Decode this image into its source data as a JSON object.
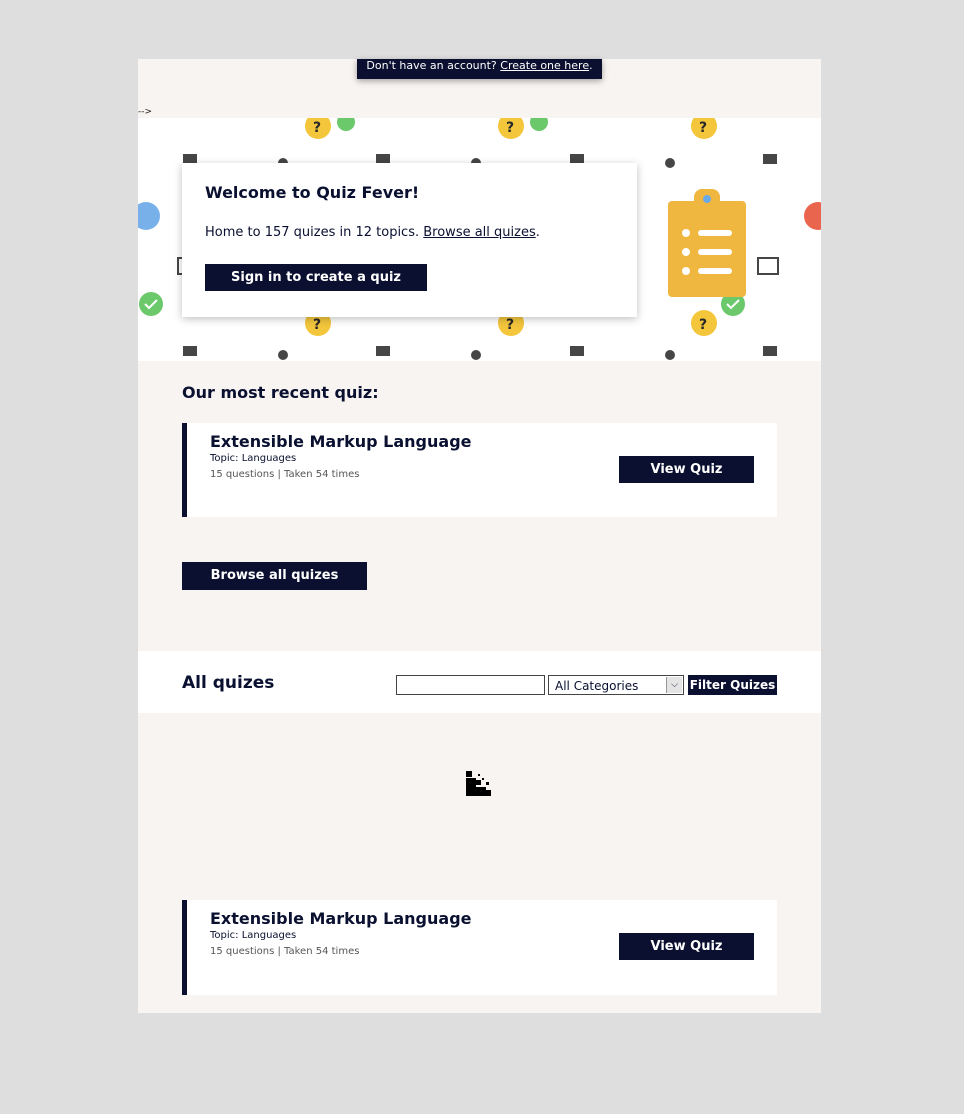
{
  "account_bar": {
    "prefix": "Don't have an account?",
    "link": "Create one here",
    "suffix": "."
  },
  "stray_text": "-->",
  "welcome": {
    "title": "Welcome to Quiz Fever!",
    "description": "Home to 157 quizes in 12 topics.",
    "browse_link": "Browse all quizes",
    "period": ".",
    "signin_button": "Sign in to create a quiz"
  },
  "recent": {
    "heading": "Our most recent quiz:",
    "quiz": {
      "title": "Extensible Markup Language",
      "topic": "Topic: Languages",
      "meta": "15 questions | Taken 54 times",
      "button": "View Quiz"
    },
    "browse_button": "Browse all quizes"
  },
  "all_quizes": {
    "heading": "All quizes",
    "search_value": "",
    "category_selected": "All Categories",
    "filter_button": "Filter Quizes",
    "items": [
      {
        "title": "Extensible Markup Language",
        "topic": "Topic: Languages",
        "meta": "15 questions | Taken 54 times",
        "button": "View Quiz"
      }
    ]
  },
  "colors": {
    "navy": "#0b1030",
    "clipboard": "#efb73f",
    "page_bg": "#f8f4f1",
    "outer_bg": "#dedede"
  },
  "icons": [
    "clipboard-icon",
    "loading-icon",
    "question-bubble-icon",
    "check-bubble-icon"
  ]
}
